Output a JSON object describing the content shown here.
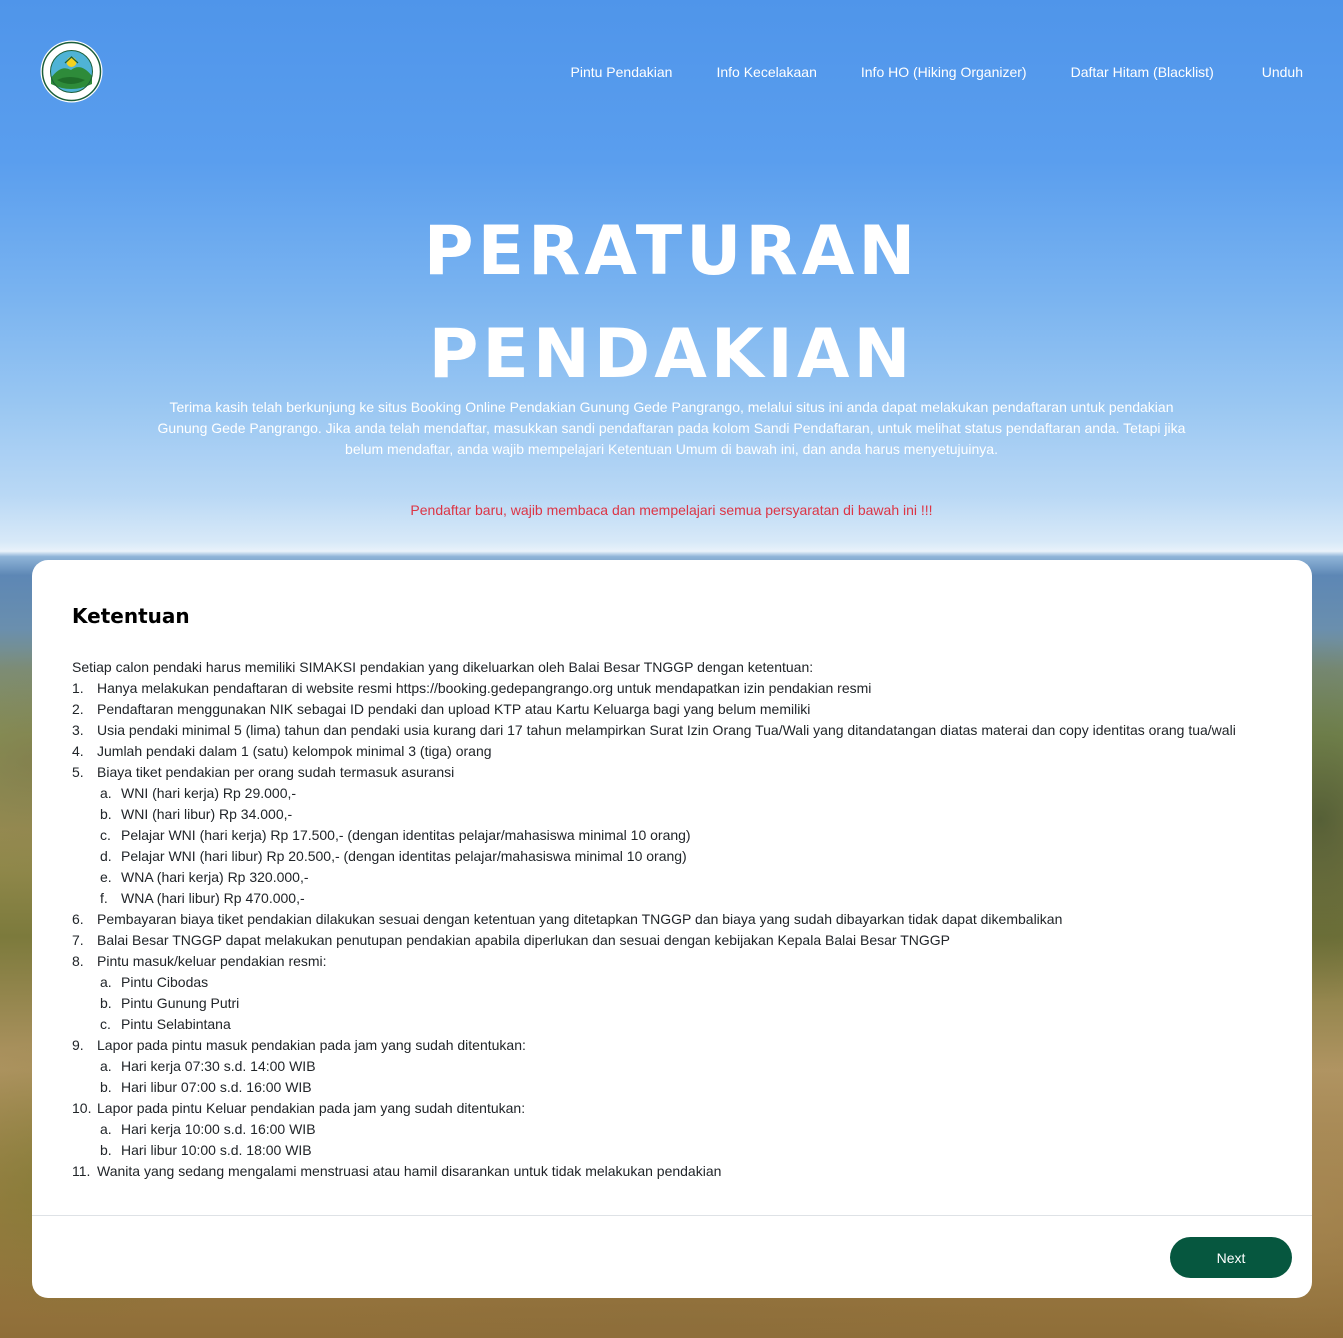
{
  "brand": {
    "logo_top_text": "TAMAN NASIONAL",
    "logo_bottom_text": "GUNUNG GEDE PANGRANGO"
  },
  "nav": {
    "items": [
      {
        "label": "Pintu Pendakian"
      },
      {
        "label": "Info Kecelakaan"
      },
      {
        "label": "Info HO (Hiking Organizer)"
      },
      {
        "label": "Daftar Hitam (Blacklist)"
      },
      {
        "label": "Unduh"
      }
    ]
  },
  "hero": {
    "title_line1": "PERATURAN",
    "title_line2": "PENDAKIAN",
    "description": "Terima kasih telah berkunjung ke situs Booking Online Pendakian Gunung Gede Pangrango, melalui situs ini anda dapat melakukan pendaftaran untuk pendakian Gunung Gede Pangrango. Jika anda telah mendaftar, masukkan sandi pendaftaran pada kolom Sandi Pendaftaran, untuk melihat status pendaftaran anda. Tetapi jika belum mendaftar, anda wajib mempelajari Ketentuan Umum di bawah ini, dan anda harus menyetujuinya.",
    "warning": "Pendaftar baru, wajib membaca dan mempelajari semua persyaratan di bawah ini !!!",
    "warning_color": "#dc3545"
  },
  "card": {
    "title": "Ketentuan",
    "intro": "Setiap calon pendaki harus memiliki SIMAKSI pendakian yang dikeluarkan oleh Balai Besar TNGGP dengan ketentuan:",
    "rules": [
      {
        "num": "1.",
        "text": "Hanya melakukan pendaftaran di website resmi https://booking.gedepangrango.org untuk mendapatkan izin pendakian resmi",
        "subs": []
      },
      {
        "num": "2.",
        "text": "Pendaftaran menggunakan NIK sebagai ID pendaki dan upload KTP atau Kartu Keluarga bagi yang belum memiliki",
        "subs": []
      },
      {
        "num": "3.",
        "text": "Usia pendaki minimal 5 (lima) tahun dan pendaki usia kurang dari 17 tahun melampirkan Surat Izin Orang Tua/Wali yang ditandatangan diatas materai dan copy identitas orang tua/wali",
        "subs": []
      },
      {
        "num": "4.",
        "text": "Jumlah pendaki dalam 1 (satu) kelompok minimal 3 (tiga) orang",
        "subs": []
      },
      {
        "num": "5.",
        "text": "Biaya tiket pendakian per orang sudah termasuk asuransi",
        "subs": [
          {
            "letter": "a.",
            "text": "WNI (hari kerja) Rp 29.000,-"
          },
          {
            "letter": "b.",
            "text": "WNI (hari libur) Rp 34.000,-"
          },
          {
            "letter": "c.",
            "text": "Pelajar WNI (hari kerja) Rp 17.500,- (dengan identitas pelajar/mahasiswa minimal 10 orang)"
          },
          {
            "letter": "d.",
            "text": "Pelajar WNI (hari libur) Rp 20.500,- (dengan identitas pelajar/mahasiswa minimal 10 orang)"
          },
          {
            "letter": "e.",
            "text": "WNA (hari kerja) Rp 320.000,-"
          },
          {
            "letter": "f.",
            "text": "WNA (hari libur) Rp 470.000,-"
          }
        ]
      },
      {
        "num": "6.",
        "text": "Pembayaran biaya tiket pendakian dilakukan sesuai dengan ketentuan yang ditetapkan TNGGP dan biaya yang sudah dibayarkan tidak dapat dikembalikan",
        "subs": []
      },
      {
        "num": "7.",
        "text": "Balai Besar TNGGP dapat melakukan penutupan pendakian apabila diperlukan dan sesuai dengan kebijakan Kepala Balai Besar TNGGP",
        "subs": []
      },
      {
        "num": "8.",
        "text": "Pintu masuk/keluar pendakian resmi:",
        "subs": [
          {
            "letter": "a.",
            "text": "Pintu Cibodas"
          },
          {
            "letter": "b.",
            "text": "Pintu Gunung Putri"
          },
          {
            "letter": "c.",
            "text": "Pintu Selabintana"
          }
        ]
      },
      {
        "num": "9.",
        "text": "Lapor pada pintu masuk pendakian pada jam yang sudah ditentukan:",
        "subs": [
          {
            "letter": "a.",
            "text": "Hari kerja 07:30 s.d. 14:00 WIB"
          },
          {
            "letter": "b.",
            "text": "Hari libur 07:00 s.d. 16:00 WIB"
          }
        ]
      },
      {
        "num": "10.",
        "text": "Lapor pada pintu Keluar pendakian pada jam yang sudah ditentukan:",
        "subs": [
          {
            "letter": "a.",
            "text": "Hari kerja 10:00 s.d. 16:00 WIB"
          },
          {
            "letter": "b.",
            "text": "Hari libur 10:00 s.d. 18:00 WIB"
          }
        ]
      },
      {
        "num": "11.",
        "text": "Wanita yang sedang mengalami menstruasi atau hamil disarankan untuk tidak melakukan pendakian",
        "subs": []
      }
    ],
    "next_label": "Next",
    "button_color": "#06573f"
  }
}
